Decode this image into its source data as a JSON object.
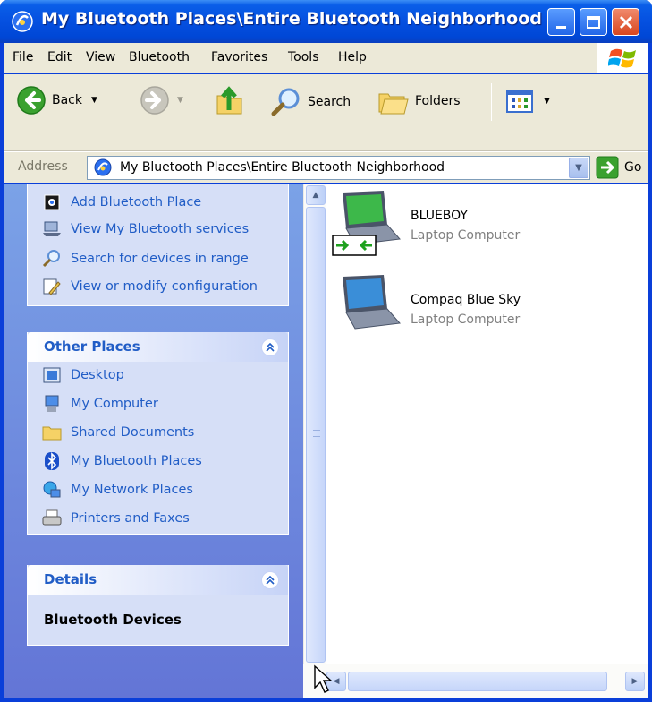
{
  "window": {
    "title": "My Bluetooth Places\\Entire Bluetooth Neighborhood"
  },
  "menu": [
    "File",
    "Edit",
    "View",
    "Bluetooth",
    "Favorites",
    "Tools",
    "Help"
  ],
  "toolbar": {
    "back_label": "Back",
    "search_label": "Search",
    "folders_label": "Folders"
  },
  "address": {
    "label": "Address",
    "value": "My Bluetooth Places\\Entire Bluetooth Neighborhood",
    "go_label": "Go"
  },
  "bluetooth_tasks": [
    {
      "label": "Add Bluetooth Place",
      "icon": "add-bluetooth-place-icon"
    },
    {
      "label": "View My Bluetooth services",
      "icon": "bluetooth-services-icon"
    },
    {
      "label": "Search for devices in range",
      "icon": "search-icon"
    },
    {
      "label": "View or modify configuration",
      "icon": "configuration-icon"
    }
  ],
  "other_places": {
    "title": "Other Places",
    "items": [
      {
        "label": "Desktop",
        "icon": "desktop-icon"
      },
      {
        "label": "My Computer",
        "icon": "my-computer-icon"
      },
      {
        "label": "Shared Documents",
        "icon": "folder-icon"
      },
      {
        "label": "My Bluetooth Places",
        "icon": "bluetooth-icon"
      },
      {
        "label": "My Network Places",
        "icon": "network-places-icon"
      },
      {
        "label": "Printers and Faxes",
        "icon": "printer-icon"
      }
    ]
  },
  "details": {
    "title": "Details",
    "text": "Bluetooth Devices"
  },
  "devices": [
    {
      "name": "BLUEBOY",
      "type": "Laptop Computer",
      "connected": true
    },
    {
      "name": "Compaq Blue Sky",
      "type": "Laptop Computer",
      "connected": false
    }
  ],
  "colors": {
    "title_bar": "#0550e0",
    "task_link": "#215dc6",
    "task_pane": "#7ba2e7"
  }
}
